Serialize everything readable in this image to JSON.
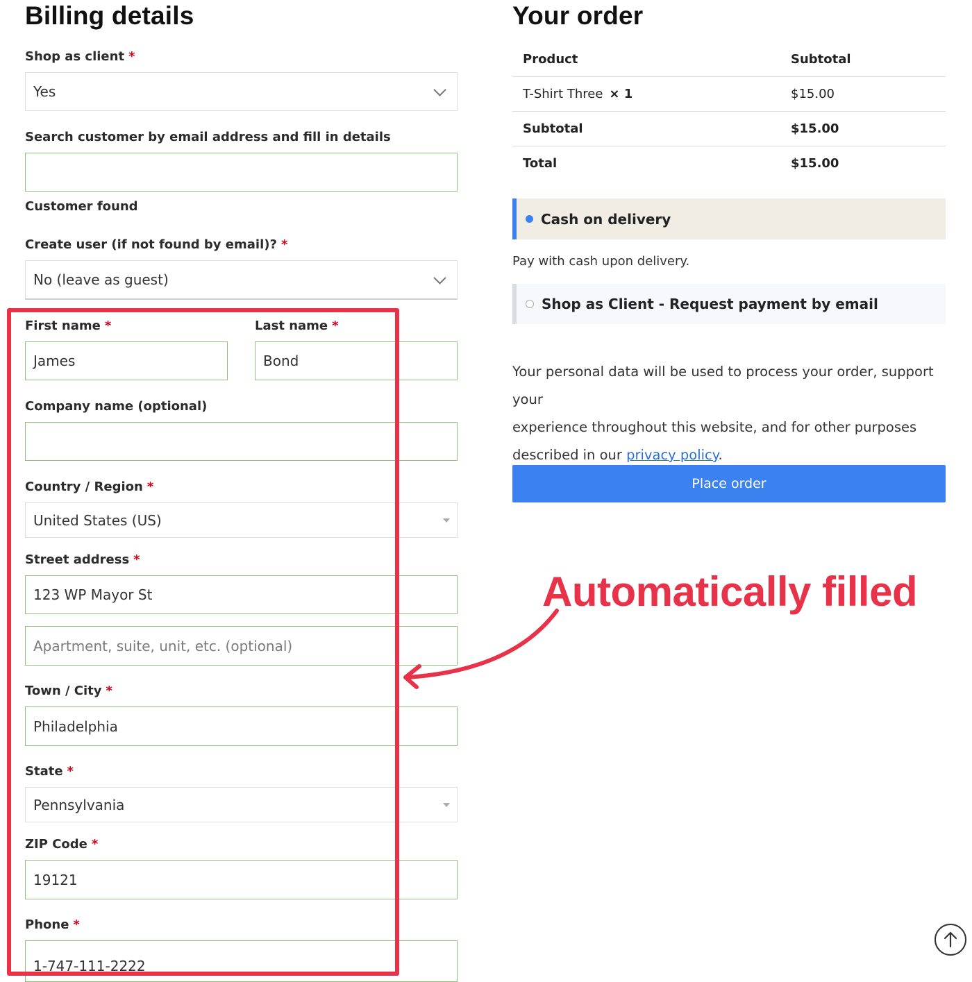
{
  "billing": {
    "title": "Billing details",
    "shop_as_client": {
      "label": "Shop as client",
      "value": "Yes"
    },
    "search_customer": {
      "label": "Search customer by email address and fill in details",
      "value": ""
    },
    "customer_found": "Customer found",
    "create_user": {
      "label": "Create user (if not found by email)?",
      "value": "No (leave as guest)"
    },
    "first_name": {
      "label": "First name",
      "value": "James"
    },
    "last_name": {
      "label": "Last name",
      "value": "Bond"
    },
    "company": {
      "label": "Company name (optional)",
      "value": ""
    },
    "country": {
      "label": "Country / Region",
      "value": "United States (US)"
    },
    "street": {
      "label": "Street address",
      "value": "123 WP Mayor St",
      "placeholder2": "Apartment, suite, unit, etc. (optional)"
    },
    "city": {
      "label": "Town / City",
      "value": "Philadelphia"
    },
    "state": {
      "label": "State",
      "value": "Pennsylvania"
    },
    "zip": {
      "label": "ZIP Code",
      "value": "19121"
    },
    "phone": {
      "label": "Phone",
      "value": "1-747-111-2222"
    },
    "required_marker": "*"
  },
  "order": {
    "title": "Your order",
    "col_product": "Product",
    "col_subtotal": "Subtotal",
    "item_name": "T-Shirt Three",
    "item_qty": "× 1",
    "item_price": "$15.00",
    "subtotal_label": "Subtotal",
    "subtotal_value": "$15.00",
    "total_label": "Total",
    "total_value": "$15.00"
  },
  "payment": {
    "method1": "Cash on delivery",
    "method1_desc": "Pay with cash upon delivery.",
    "method2": "Shop as Client - Request payment by email",
    "privacy_text_1": "Your personal data will be used to process your order, support your",
    "privacy_text_2": "experience throughout this website, and for other purposes",
    "privacy_text_3": "described in our",
    "privacy_link": "privacy policy",
    "privacy_end": ".",
    "place_order": "Place order"
  },
  "annotation": {
    "text": "Automatically filled",
    "color": "#e8324a"
  },
  "colors": {
    "accent": "#3b82f0",
    "required": "#d0021b",
    "valid_border": "#8ec07c"
  }
}
